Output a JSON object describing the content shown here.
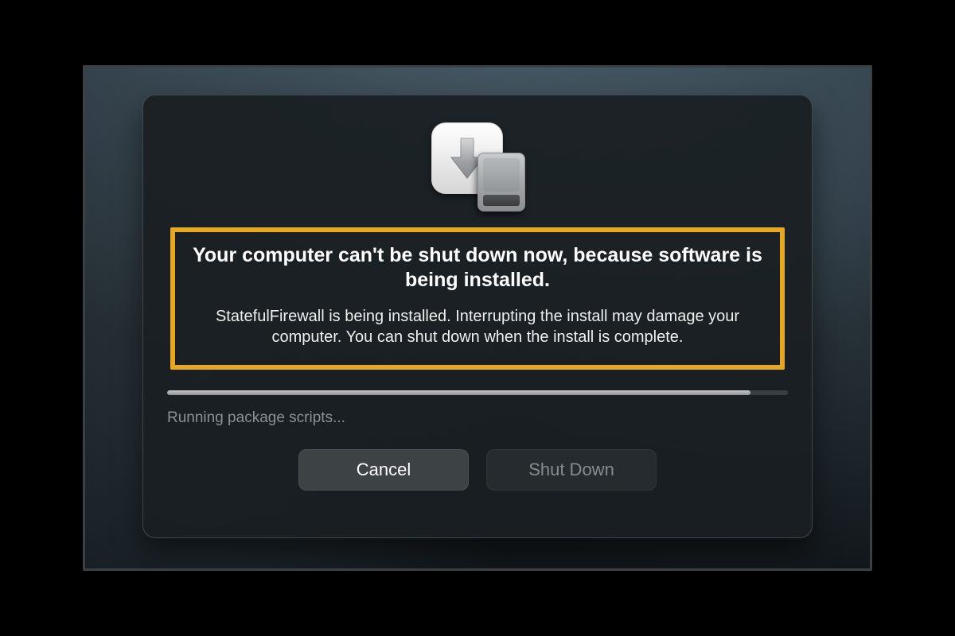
{
  "dialog": {
    "heading": "Your computer can't be shut down now, because software is being installed.",
    "subtext": "StatefulFirewall is being installed. Interrupting the install may damage your computer. You can shut down when the install is complete.",
    "progress": {
      "percent": 94,
      "status": "Running package scripts..."
    },
    "buttons": {
      "cancel": "Cancel",
      "shutdown": "Shut Down",
      "shutdown_enabled": false
    },
    "icon_name": "installer-disk-icon",
    "highlight_color": "#e6a81f"
  }
}
